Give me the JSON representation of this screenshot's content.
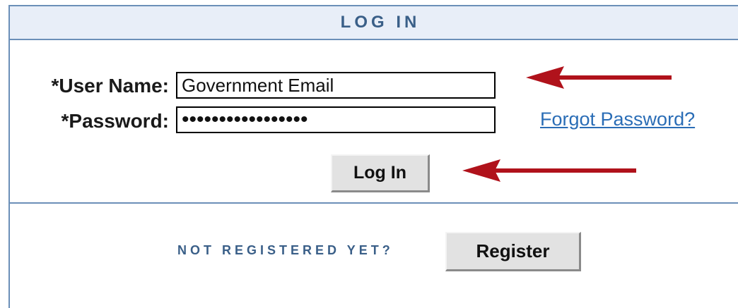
{
  "header": {
    "title": "LOG IN"
  },
  "form": {
    "username_label": "*User Name:",
    "username_value": "Government Email",
    "password_label": "*Password:",
    "password_value": "xxxxxxxxxxxxxxxxx",
    "forgot_link": "Forgot Password?",
    "login_button": "Log In"
  },
  "register": {
    "prompt": "NOT REGISTERED YET?",
    "button": "Register"
  },
  "colors": {
    "accent": "#3a5f88",
    "border": "#6b8fb8",
    "header_bg": "#e8eef8",
    "link": "#2a6db6",
    "arrow": "#b0121b"
  }
}
